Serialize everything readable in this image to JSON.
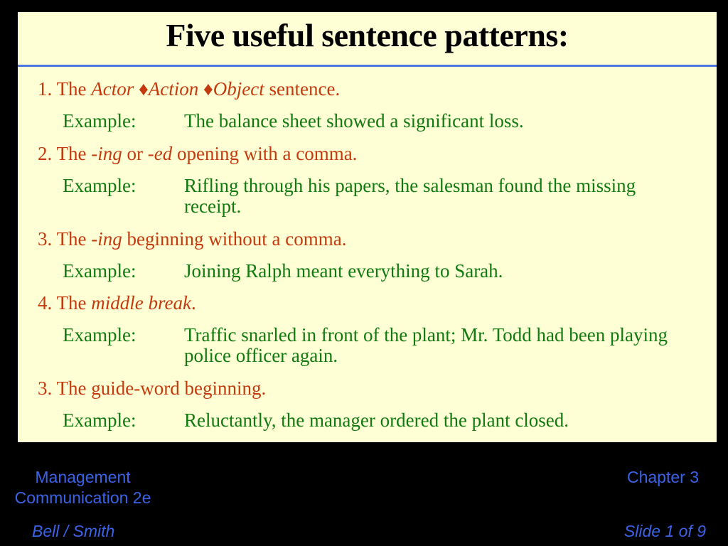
{
  "slide": {
    "title": "Five useful sentence patterns:",
    "items": [
      {
        "num": "1. The ",
        "parts": [
          "Actor",
          "♦",
          "Action",
          "♦",
          "Object"
        ],
        "tail": " sentence.",
        "example_label": "Example:",
        "example": "The balance sheet showed a significant loss."
      },
      {
        "num": "2. The ",
        "it1": "-ing",
        "mid": " or ",
        "it2": "-ed",
        "tail": " opening with a comma.",
        "example_label": "Example:",
        "example": "Rifling through his papers, the salesman found the missing receipt."
      },
      {
        "num": "3. The ",
        "it1": "-ing",
        "tail": " beginning without a comma.",
        "example_label": "Example:",
        "example": "Joining Ralph meant everything to Sarah."
      },
      {
        "num": "4. The ",
        "it1": "middle break",
        "tail": ".",
        "example_label": "Example:",
        "example": "Traffic snarled in front of the plant; Mr. Todd had been playing police officer again."
      },
      {
        "num": "3. The guide-word beginning.",
        "example_label": "Example:",
        "example": "Reluctantly, the manager ordered the plant closed."
      }
    ]
  },
  "footer": {
    "book_line1": "Management",
    "book_line2": "Communication 2e",
    "authors": "Bell / Smith",
    "chapter": "Chapter 3",
    "slide_number": "Slide 1 of 9"
  },
  "colors": {
    "panel": "#ffffd6",
    "heading": "#c43a0e",
    "example": "#107a10",
    "footer": "#3a63e6",
    "rule": "#4a78e0"
  }
}
